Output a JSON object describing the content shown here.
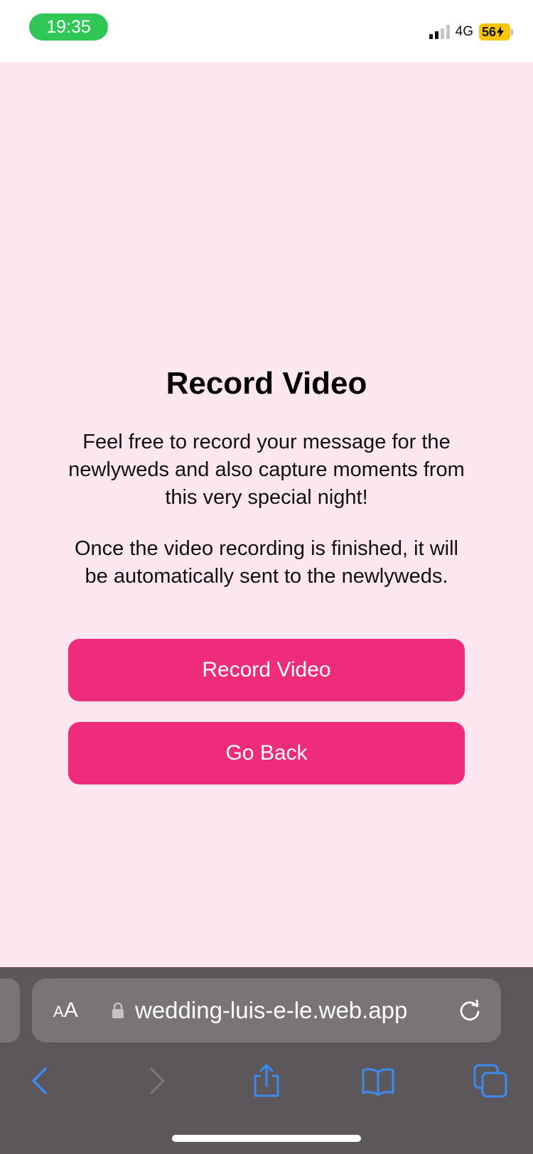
{
  "status_bar": {
    "time": "19:35",
    "network": "4G",
    "battery": "56",
    "time_pill_color": "#30c756",
    "battery_color": "#ffc600"
  },
  "page": {
    "title": "Record Video",
    "paragraph1": "Feel free to record your message for the newlyweds and also capture moments from this very special night!",
    "paragraph2": "Once the video recording is finished, it will be automatically sent to the newlyweds.",
    "record_button": "Record Video",
    "back_button": "Go Back",
    "background_color": "#fce6f0",
    "accent_color": "#ef2c7c"
  },
  "browser": {
    "text_size_button_small": "A",
    "text_size_button_large": "A",
    "url": "wedding-luis-e-le.web.app",
    "icons": [
      "lock-icon",
      "reload-icon",
      "back-arrow-icon",
      "forward-arrow-icon",
      "share-icon",
      "bookmarks-icon",
      "tabs-icon"
    ],
    "toolbar_icon_color": "#3d8bf0"
  }
}
